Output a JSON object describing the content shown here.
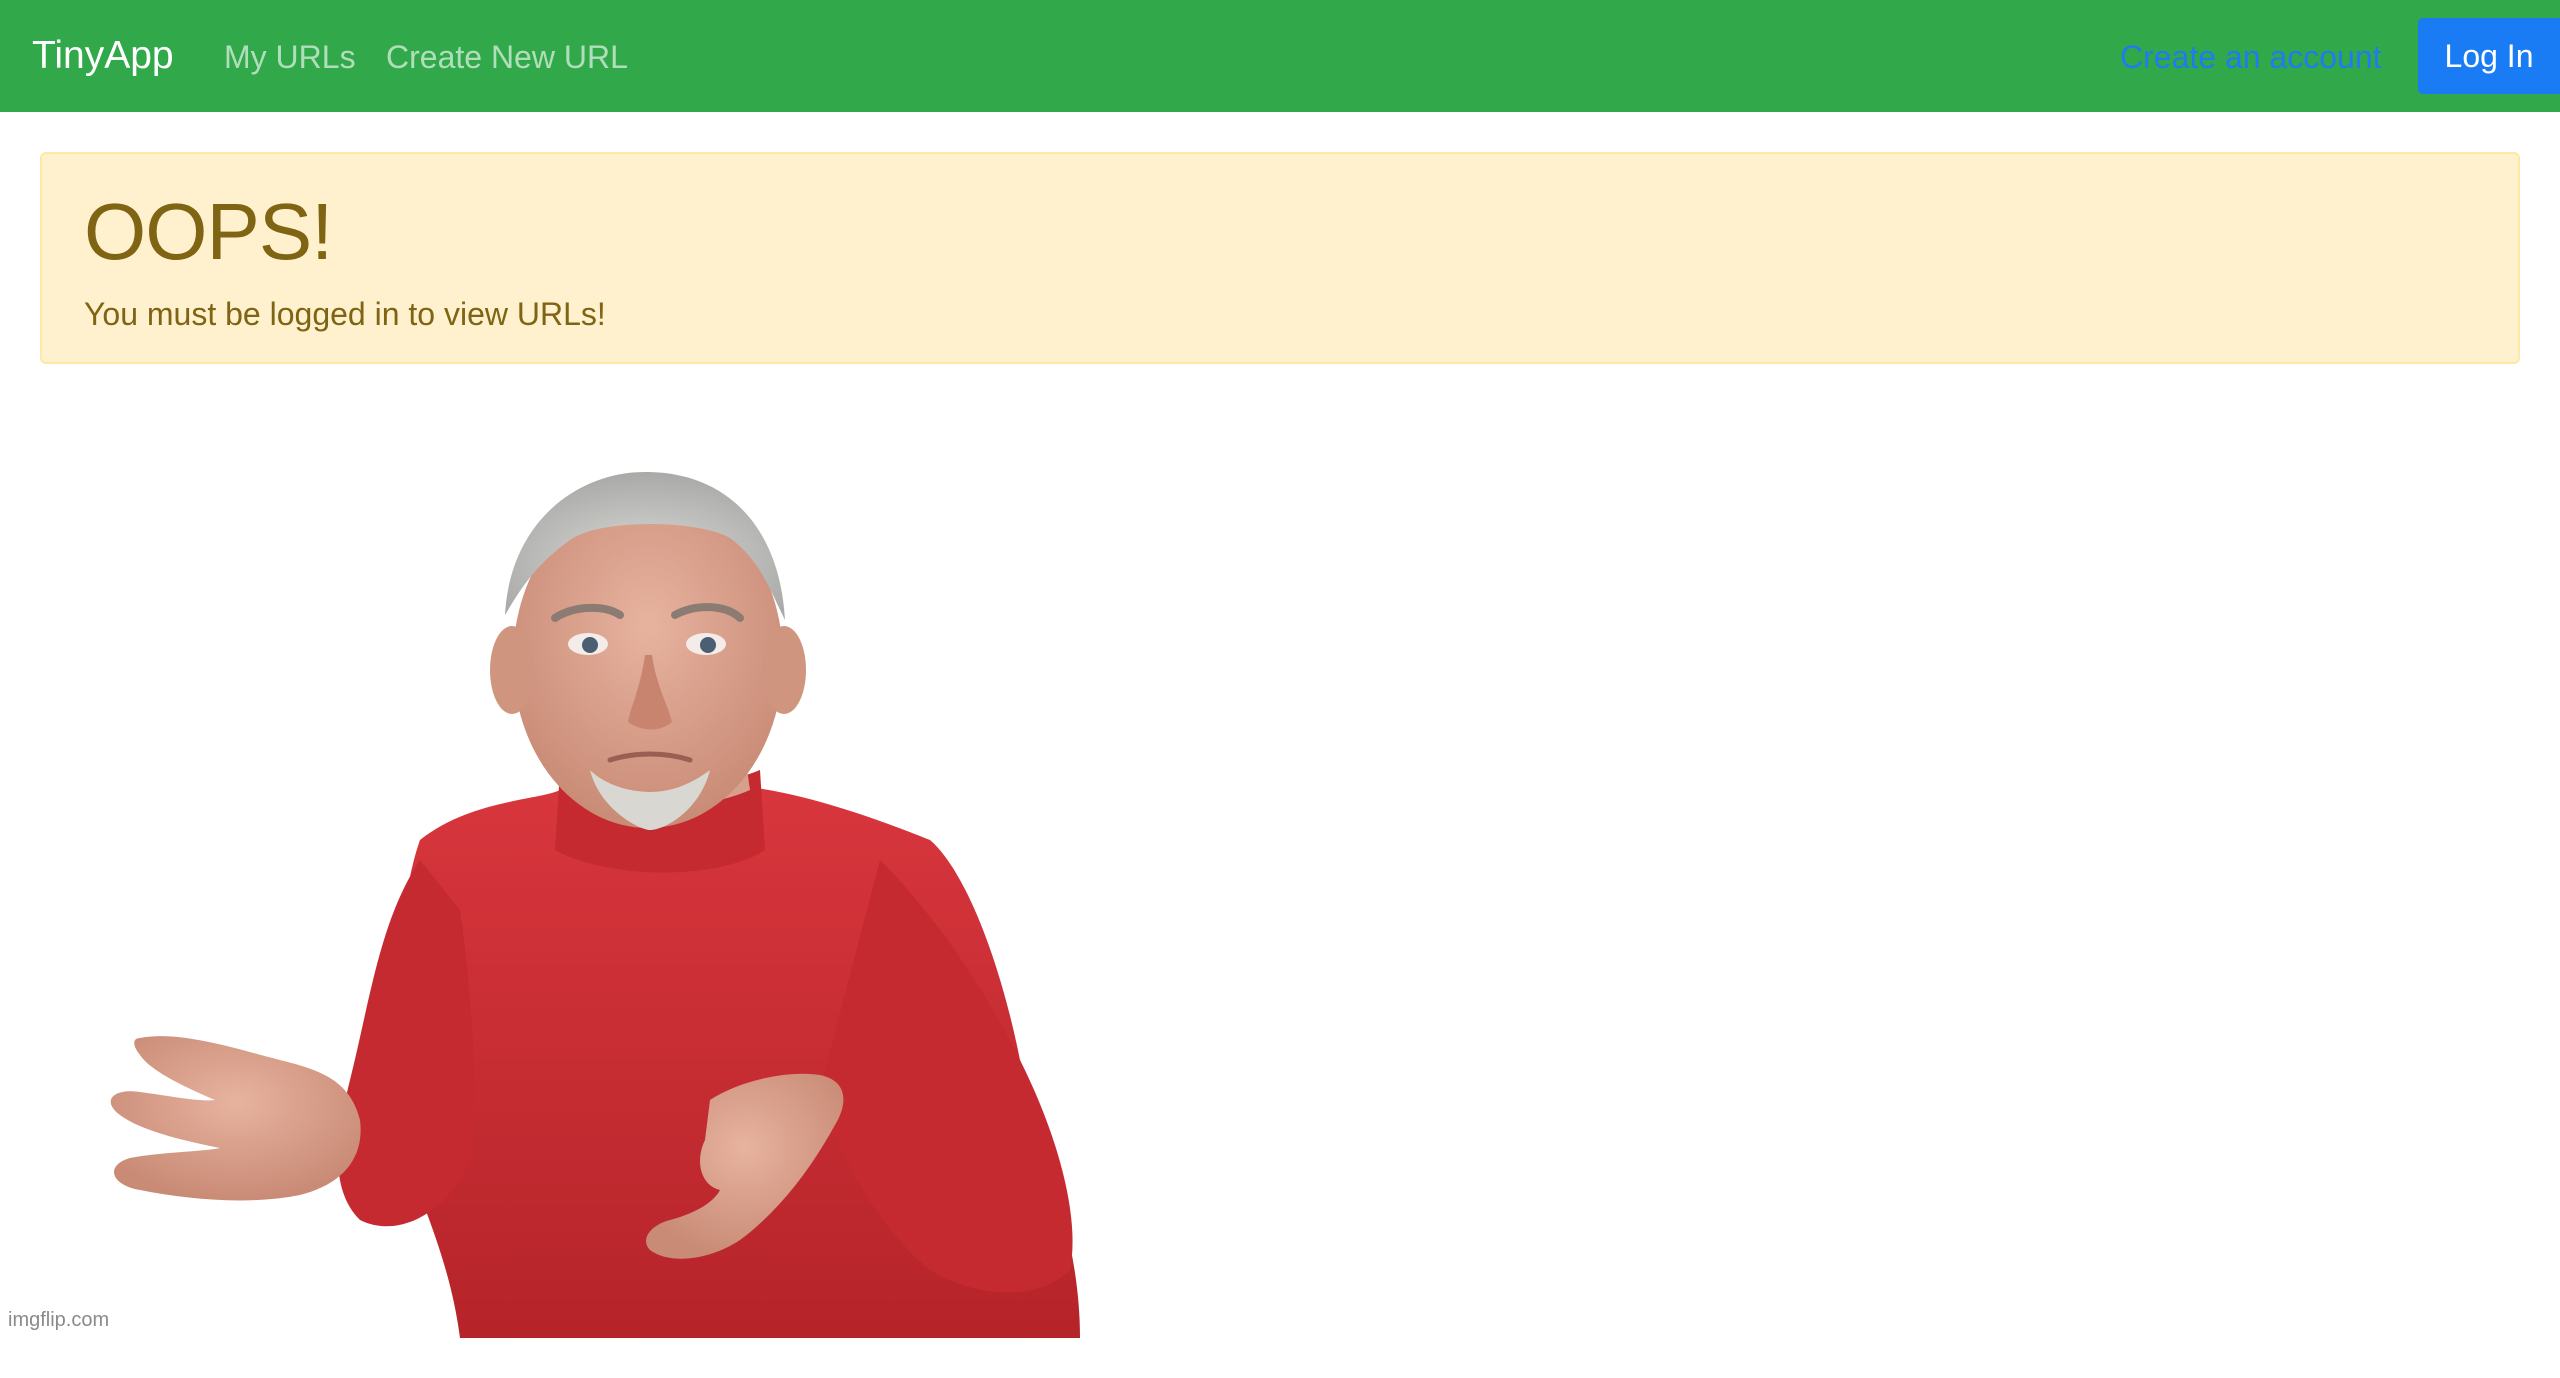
{
  "navbar": {
    "brand": "TinyApp",
    "links": [
      {
        "label": "My URLs"
      },
      {
        "label": "Create New URL"
      }
    ],
    "register_label": "Create an account",
    "login_label": "Log In",
    "colors": {
      "background": "#31a84a",
      "register_link": "#1f7cf0",
      "login_button": "#1a7cf5"
    }
  },
  "alert": {
    "heading": "OOPS!",
    "message": "You must be logged in to view URLs!",
    "colors": {
      "background": "#fff1cd",
      "border": "#fde8a7",
      "text": "#7f6414"
    }
  },
  "meme": {
    "icon": "shrugging-man-image",
    "watermark": "imgflip.com"
  }
}
